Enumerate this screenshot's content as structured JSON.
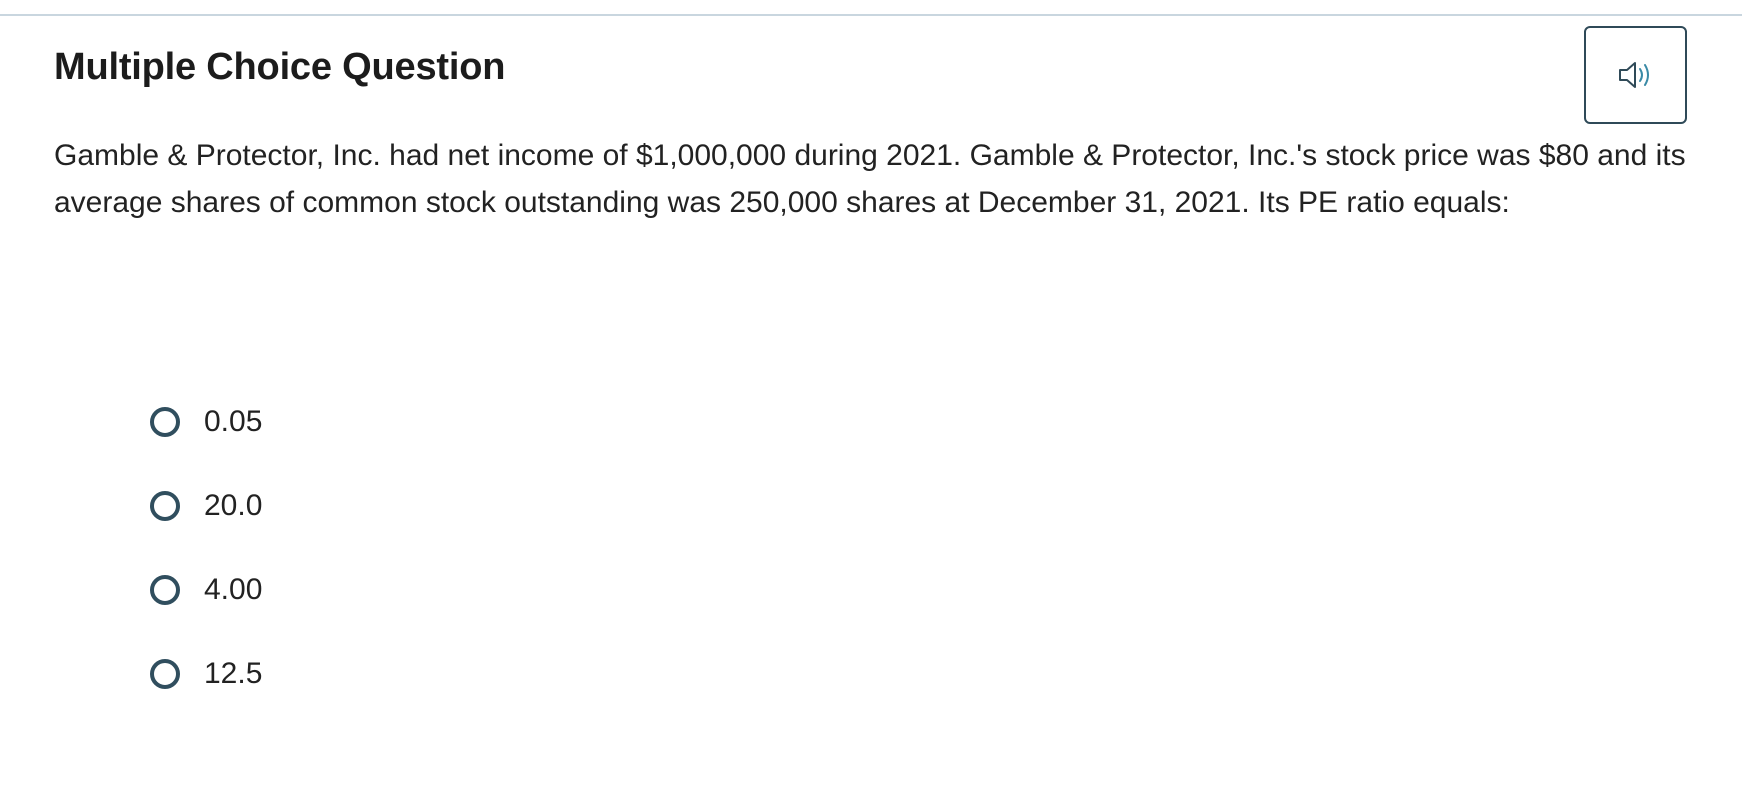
{
  "header": {
    "title": "Multiple Choice Question",
    "audio_icon": "speaker-icon"
  },
  "question": {
    "text": "Gamble & Protector, Inc. had net income of $1,000,000 during 2021. Gamble & Protector, Inc.'s stock price was $80 and its average shares of common stock outstanding was 250,000 shares at December 31, 2021. Its PE ratio equals:"
  },
  "options": [
    {
      "label": "0.05"
    },
    {
      "label": "20.0"
    },
    {
      "label": "4.00"
    },
    {
      "label": "12.5"
    }
  ],
  "colors": {
    "radio_border": "#304e5e",
    "button_border": "#2f4a58",
    "icon_accent": "#3a8aa6",
    "divider": "#c9d6df"
  }
}
